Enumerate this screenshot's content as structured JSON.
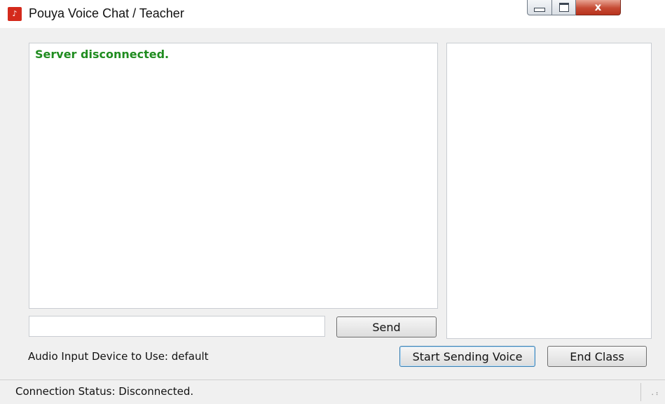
{
  "window": {
    "title": "Pouya Voice Chat / Teacher",
    "icon": "app-logo-icon",
    "caption_buttons": {
      "minimize_icon": "minimize-icon",
      "maximize_icon": "maximize-icon",
      "close_icon": "close-icon",
      "close_glyph": "x"
    }
  },
  "chat_log": {
    "messages": [
      "Server disconnected."
    ],
    "message_color": "#1f8c1f"
  },
  "message_input": {
    "value": "",
    "placeholder": ""
  },
  "buttons": {
    "send_label": "Send",
    "start_voice_label": "Start Sending Voice",
    "end_class_label": "End Class"
  },
  "audio": {
    "label": "Audio Input Device to Use: default"
  },
  "status_bar": {
    "text": "Connection Status: Disconnected."
  }
}
